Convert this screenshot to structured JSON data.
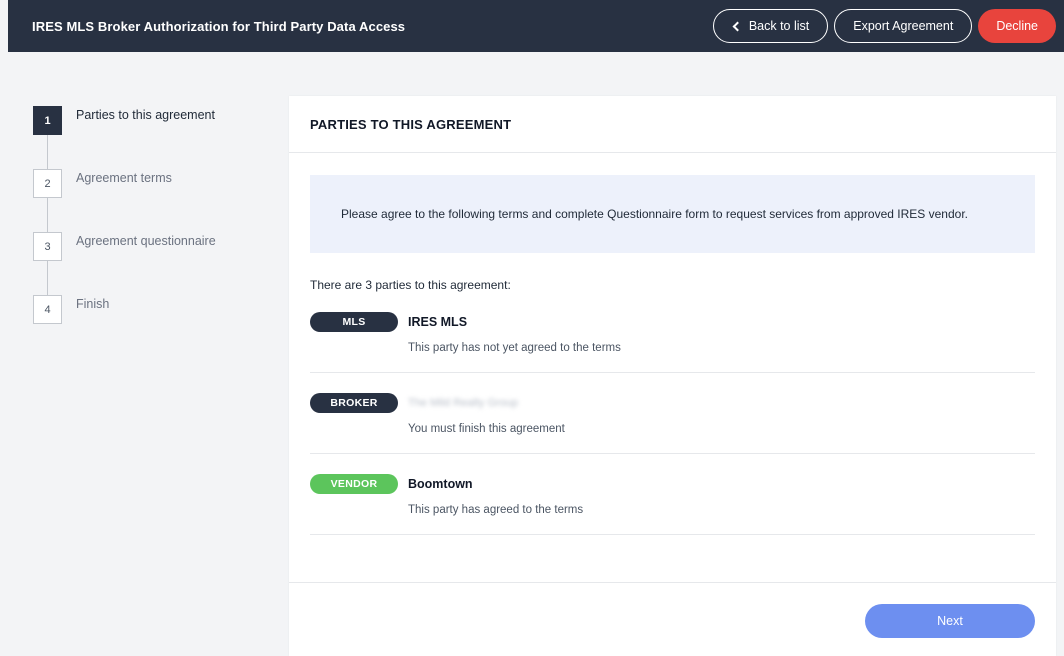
{
  "header": {
    "title": "IRES MLS Broker Authorization for Third Party Data Access",
    "back_label": "Back to list",
    "export_label": "Export Agreement",
    "decline_label": "Decline"
  },
  "steps": [
    {
      "num": "1",
      "label": "Parties to this agreement",
      "active": true
    },
    {
      "num": "2",
      "label": "Agreement terms",
      "active": false
    },
    {
      "num": "3",
      "label": "Agreement questionnaire",
      "active": false
    },
    {
      "num": "4",
      "label": "Finish",
      "active": false
    }
  ],
  "panel": {
    "title": "PARTIES TO THIS AGREEMENT",
    "notice": "Please agree to the following terms and complete Questionnaire form to request services from approved IRES vendor.",
    "parties_count": "There are 3 parties to this agreement:",
    "parties": [
      {
        "role": "MLS",
        "name": "IRES MLS",
        "status": "This party has not yet agreed to the terms"
      },
      {
        "role": "BROKER",
        "name": "The Mild Realty Group",
        "status": "You must finish this agreement"
      },
      {
        "role": "VENDOR",
        "name": "Boomtown",
        "status": "This party has agreed to the terms"
      }
    ],
    "next_label": "Next"
  },
  "colors": {
    "header_bg": "#283142",
    "decline": "#e8443d",
    "vendor_badge": "#5cc55c",
    "next_button": "#6d8ff0",
    "notice_bg": "#edf1fb"
  }
}
